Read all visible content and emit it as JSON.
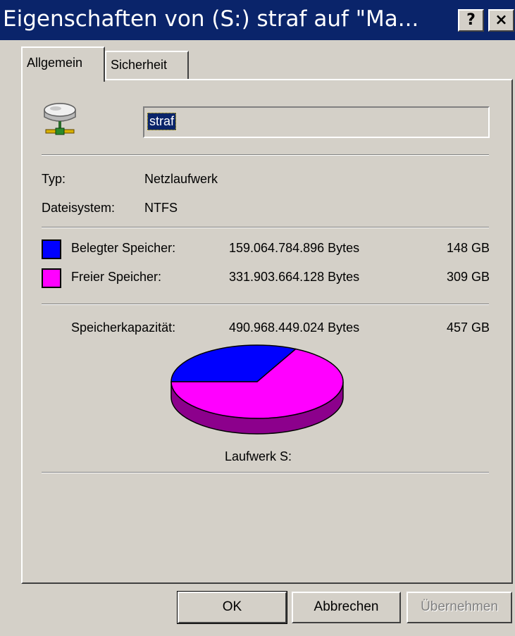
{
  "window": {
    "title": "Eigenschaften von (S:) straf auf \"Ma...",
    "help_button": "?",
    "close_button": "×"
  },
  "tabs": [
    {
      "label": "Allgemein",
      "active": true
    },
    {
      "label": "Sicherheit",
      "active": false
    }
  ],
  "drive": {
    "icon": "network-drive-icon",
    "name": "straf",
    "type_label": "Typ:",
    "type_value": "Netzlaufwerk",
    "filesystem_label": "Dateisystem:",
    "filesystem_value": "NTFS"
  },
  "usage": {
    "used": {
      "label": "Belegter Speicher:",
      "bytes": "159.064.784.896 Bytes",
      "size": "148 GB",
      "color": "#0000ff"
    },
    "free": {
      "label": "Freier Speicher:",
      "bytes": "331.903.664.128 Bytes",
      "size": "309 GB",
      "color": "#ff00ff"
    },
    "capacity": {
      "label": "Speicherkapazität:",
      "bytes": "490.968.449.024 Bytes",
      "size": "457 GB"
    }
  },
  "chart_data": {
    "type": "pie",
    "categories": [
      "Belegter Speicher",
      "Freier Speicher"
    ],
    "values": [
      159064784896,
      331903664128
    ],
    "colors": [
      "#0000ff",
      "#ff00ff"
    ],
    "label": "Laufwerk S:"
  },
  "buttons": {
    "ok": "OK",
    "cancel": "Abbrechen",
    "apply": "Übernehmen"
  }
}
